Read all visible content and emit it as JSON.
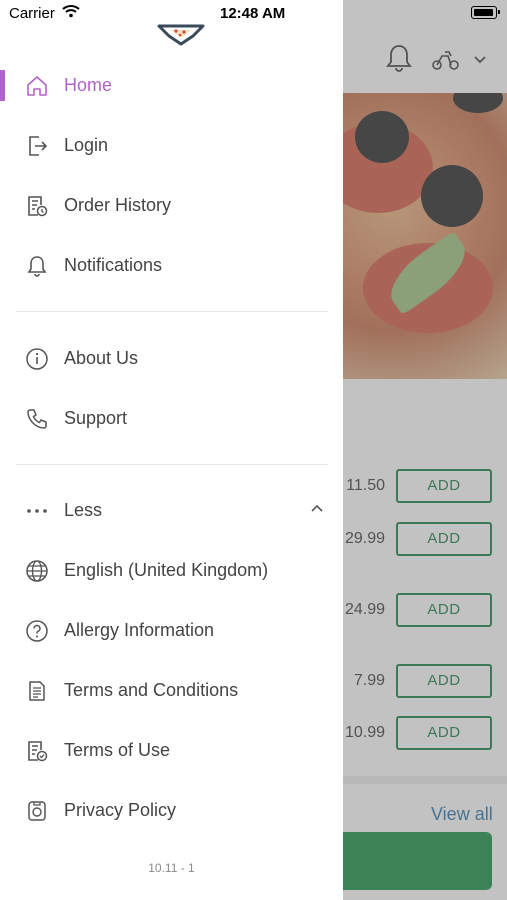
{
  "status_bar": {
    "carrier": "Carrier",
    "time": "12:48 AM"
  },
  "drawer": {
    "menu": [
      {
        "label": "Home",
        "icon": "home-icon",
        "active": true
      },
      {
        "label": "Login",
        "icon": "login-icon"
      },
      {
        "label": "Order History",
        "icon": "order-history-icon"
      },
      {
        "label": "Notifications",
        "icon": "bell-icon"
      }
    ],
    "info": [
      {
        "label": "About Us",
        "icon": "info-icon"
      },
      {
        "label": "Support",
        "icon": "phone-icon"
      }
    ],
    "more": [
      {
        "label": "Less",
        "icon": "more-dots-icon"
      },
      {
        "label": "English (United Kingdom)",
        "icon": "globe-icon"
      },
      {
        "label": "Allergy Information",
        "icon": "question-icon"
      },
      {
        "label": "Terms and Conditions",
        "icon": "document-icon"
      },
      {
        "label": "Terms of Use",
        "icon": "document-check-icon"
      },
      {
        "label": "Privacy Policy",
        "icon": "privacy-icon"
      }
    ],
    "version": "10.11 - 1",
    "accent_color": "#b063c8"
  },
  "background": {
    "prices": [
      "11.50",
      "29.99",
      "24.99",
      "7.99",
      "10.99"
    ],
    "add_label": "ADD",
    "view_all": "View all",
    "accent_green": "#0b7a3b"
  }
}
